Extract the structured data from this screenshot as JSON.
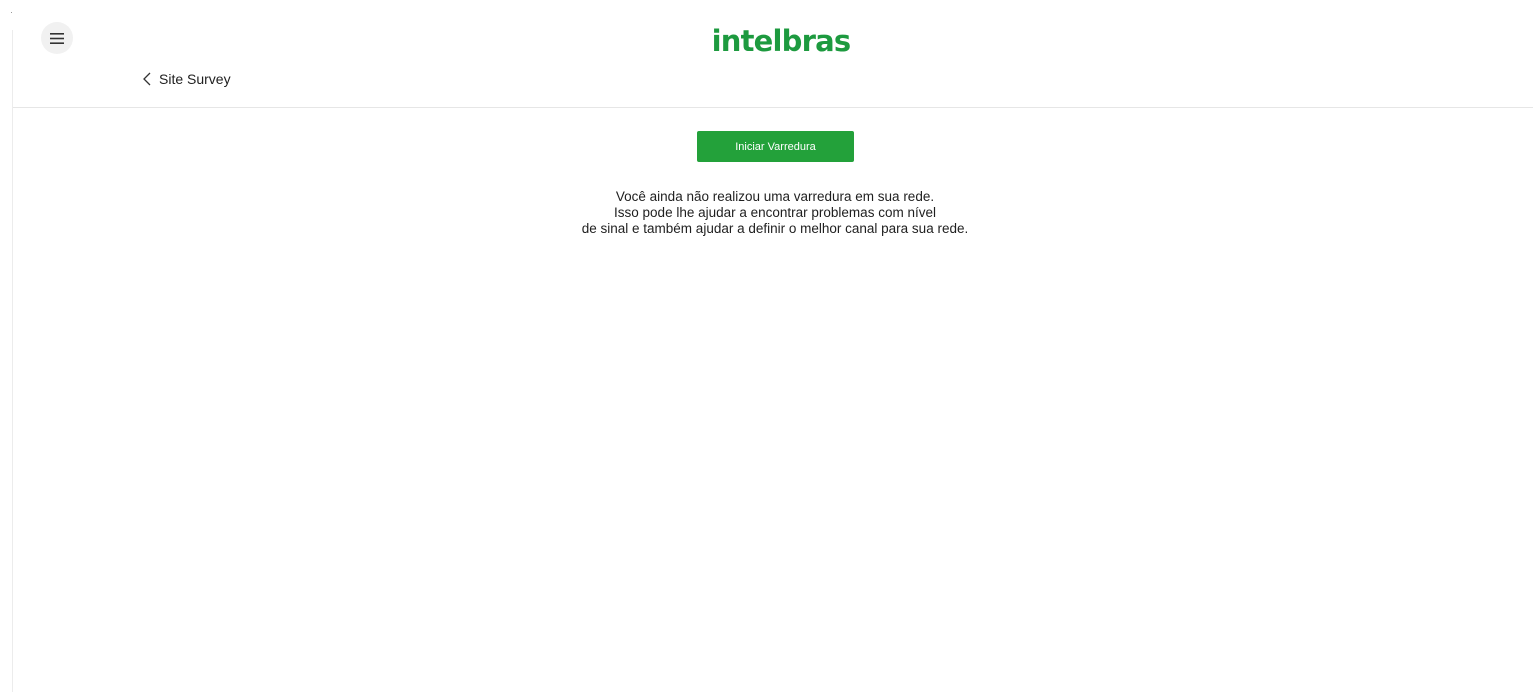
{
  "header": {
    "menu_icon": "hamburger-menu-icon",
    "logo_text": "intelbras",
    "back_icon": "chevron-left-icon",
    "page_title": "Site Survey"
  },
  "main": {
    "scan_button_label": "Iniciar Varredura",
    "empty_message": [
      "Você ainda não realizou uma varredura em sua rede.",
      "Isso pode lhe ajudar a encontrar problemas com nível",
      "de sinal e também ajudar a definir o melhor canal para sua rede."
    ]
  },
  "colors": {
    "brand_green": "#1d9a3f",
    "button_green": "#23a13a",
    "menu_button_bg": "#f1f1f1",
    "divider": "#e6e6e6"
  }
}
